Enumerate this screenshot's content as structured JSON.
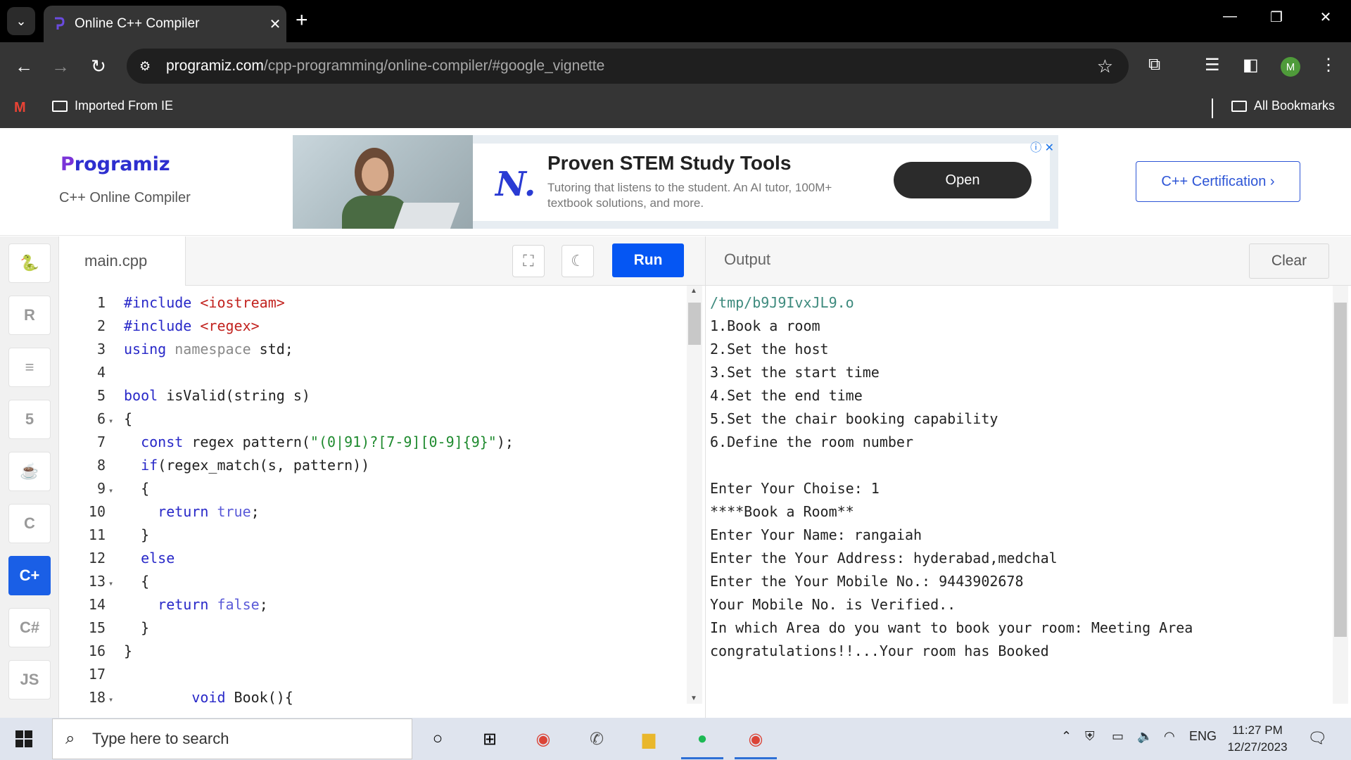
{
  "browser": {
    "tab_title": "Online C++ Compiler",
    "url_domain": "programiz.com",
    "url_path": "/cpp-programming/online-compiler/#google_vignette",
    "avatar_initial": "M",
    "bookmarks": [
      "Imported From IE"
    ],
    "all_bookmarks": "All Bookmarks",
    "gmail_label": "M"
  },
  "header": {
    "logo_text": "rogramiz",
    "logo_letter": "P",
    "subtitle": "C++ Online Compiler",
    "cert_button": "C++ Certification ›"
  },
  "ad": {
    "logo": "N.",
    "title": "Proven STEM Study Tools",
    "description": "Tutoring that listens to the student. An AI tutor, 100M+ textbook solutions, and more.",
    "cta": "Open",
    "badges": "ⓘ ✕"
  },
  "editor": {
    "file_name": "main.cpp",
    "run_label": "Run",
    "lines": [
      {
        "n": "1",
        "fold": "",
        "tokens": [
          [
            "kw",
            "#include "
          ],
          [
            "inc",
            "<iostream>"
          ]
        ]
      },
      {
        "n": "2",
        "fold": "",
        "tokens": [
          [
            "kw",
            "#include "
          ],
          [
            "inc",
            "<regex>"
          ]
        ]
      },
      {
        "n": "3",
        "fold": "",
        "tokens": [
          [
            "kw",
            "using "
          ],
          [
            "nsp",
            "namespace "
          ],
          [
            "code",
            "std;"
          ]
        ]
      },
      {
        "n": "4",
        "fold": "",
        "tokens": []
      },
      {
        "n": "5",
        "fold": "",
        "tokens": [
          [
            "kw",
            "bool "
          ],
          [
            "code",
            "isValid(string s)"
          ]
        ]
      },
      {
        "n": "6",
        "fold": "▾",
        "tokens": [
          [
            "code",
            "{"
          ]
        ]
      },
      {
        "n": "7",
        "fold": "",
        "tokens": [
          [
            "code",
            "  "
          ],
          [
            "kw",
            "const "
          ],
          [
            "code",
            "regex pattern("
          ],
          [
            "str",
            "\"(0|91)?[7-9][0-9]{9}\""
          ],
          [
            "code",
            ");"
          ]
        ]
      },
      {
        "n": "8",
        "fold": "",
        "tokens": [
          [
            "code",
            "  "
          ],
          [
            "kw",
            "if"
          ],
          [
            "code",
            "(regex_match(s, pattern))"
          ]
        ]
      },
      {
        "n": "9",
        "fold": "▾",
        "tokens": [
          [
            "code",
            "  {"
          ]
        ]
      },
      {
        "n": "10",
        "fold": "",
        "tokens": [
          [
            "code",
            "    "
          ],
          [
            "kw",
            "return "
          ],
          [
            "bool",
            "true"
          ],
          [
            "code",
            ";"
          ]
        ]
      },
      {
        "n": "11",
        "fold": "",
        "tokens": [
          [
            "code",
            "  }"
          ]
        ]
      },
      {
        "n": "12",
        "fold": "",
        "tokens": [
          [
            "code",
            "  "
          ],
          [
            "kw",
            "else"
          ]
        ]
      },
      {
        "n": "13",
        "fold": "▾",
        "tokens": [
          [
            "code",
            "  {"
          ]
        ]
      },
      {
        "n": "14",
        "fold": "",
        "tokens": [
          [
            "code",
            "    "
          ],
          [
            "kw",
            "return "
          ],
          [
            "bool",
            "false"
          ],
          [
            "code",
            ";"
          ]
        ]
      },
      {
        "n": "15",
        "fold": "",
        "tokens": [
          [
            "code",
            "  }"
          ]
        ]
      },
      {
        "n": "16",
        "fold": "",
        "tokens": [
          [
            "code",
            "}"
          ]
        ]
      },
      {
        "n": "17",
        "fold": "",
        "tokens": []
      },
      {
        "n": "18",
        "fold": "▾",
        "tokens": [
          [
            "code",
            "        "
          ],
          [
            "kw",
            "void "
          ],
          [
            "code",
            "Book(){"
          ]
        ]
      }
    ]
  },
  "output": {
    "title": "Output",
    "clear_label": "Clear",
    "lines": [
      "/tmp/b9J9IvxJL9.o",
      "1.Book a room",
      "2.Set the host",
      "3.Set the start time",
      "4.Set the end time",
      "5.Set the chair booking capability",
      "6.Define the room number",
      "",
      "Enter Your Choise: 1",
      "****Book a Room**",
      "Enter Your Name: rangaiah",
      "Enter the Your Address: hyderabad,medchal",
      "Enter the Your Mobile No.: 9443902678",
      "Your Mobile No. is Verified..",
      "In which Area do you want to book your room: Meeting Area",
      "congratulations!!...Your room has Booked"
    ]
  },
  "sidebar": {
    "languages": [
      {
        "name": "python",
        "glyph": "🐍",
        "active": false
      },
      {
        "name": "r",
        "glyph": "R",
        "active": false
      },
      {
        "name": "sql",
        "glyph": "≡",
        "active": false
      },
      {
        "name": "html",
        "glyph": "5",
        "active": false
      },
      {
        "name": "java",
        "glyph": "☕",
        "active": false
      },
      {
        "name": "c",
        "glyph": "C",
        "active": false
      },
      {
        "name": "cpp",
        "glyph": "C+",
        "active": true
      },
      {
        "name": "csharp",
        "glyph": "C#",
        "active": false
      },
      {
        "name": "js",
        "glyph": "JS",
        "active": false
      }
    ]
  },
  "taskbar": {
    "search_placeholder": "Type here to search",
    "lang": "ENG",
    "time": "11:27 PM",
    "date": "12/27/2023"
  }
}
